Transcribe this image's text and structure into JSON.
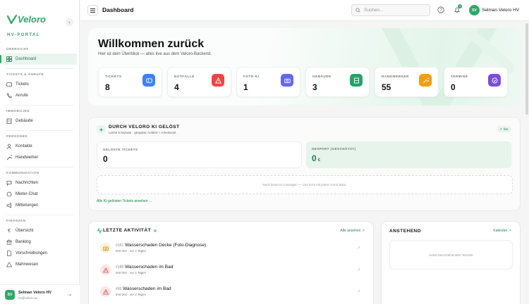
{
  "sidebar": {
    "brand": "Veloro",
    "portal": "HV-PORTAL",
    "sections": [
      {
        "title": "ÜBERSICHT",
        "items": [
          {
            "label": "Dashboard",
            "icon": "dashboard-icon",
            "active": true
          }
        ]
      },
      {
        "title": "TICKETS & ANRUFE",
        "items": [
          {
            "label": "Tickets",
            "icon": "ticket-icon"
          },
          {
            "label": "Anrufe",
            "icon": "phone-icon"
          }
        ]
      },
      {
        "title": "IMMOBILIEN",
        "items": [
          {
            "label": "Gebäude",
            "icon": "building-icon"
          }
        ]
      },
      {
        "title": "PERSONEN",
        "items": [
          {
            "label": "Kontakte",
            "icon": "contacts-icon"
          },
          {
            "label": "Handwerker",
            "icon": "wrench-icon"
          }
        ]
      },
      {
        "title": "KOMMUNIKATION",
        "items": [
          {
            "label": "Nachrichten",
            "icon": "message-icon"
          },
          {
            "label": "Mieter-Chat",
            "icon": "chat-icon"
          },
          {
            "label": "Mitteilungen",
            "icon": "megaphone-icon"
          }
        ]
      },
      {
        "title": "FINANZEN",
        "items": [
          {
            "label": "Übersicht",
            "icon": "euro-icon"
          },
          {
            "label": "Banking",
            "icon": "bank-icon"
          },
          {
            "label": "Vorschreibungen",
            "icon": "document-icon"
          },
          {
            "label": "Mahnwesen",
            "icon": "warning-icon"
          }
        ]
      }
    ],
    "user": {
      "initials": "SV",
      "name": "Selman Veloro HV",
      "email": "hv@veloro.at"
    }
  },
  "topbar": {
    "title": "Dashboard",
    "search_placeholder": "Suchen...",
    "notifications": "3",
    "user_initials": "SV",
    "user_name": "Selman Veloro HV"
  },
  "hero": {
    "title": "Willkommen zurück",
    "subtitle": "Hier ist dein Überblick — alles live aus dem Veloro-Backend.",
    "stats": [
      {
        "label": "TICKETS",
        "value": "8",
        "icon": "ticket-icon",
        "color": "#3b82f6"
      },
      {
        "label": "NOTFÄLLE",
        "value": "4",
        "icon": "alert-icon",
        "color": "#ef4444"
      },
      {
        "label": "FOTO-KI",
        "value": "1",
        "icon": "camera-icon",
        "color": "#6366f1"
      },
      {
        "label": "GEBÄUDE",
        "value": "3",
        "icon": "building-icon",
        "color": "#22a36a"
      },
      {
        "label": "HANDWERKER",
        "value": "55",
        "icon": "wrench-icon",
        "color": "#f59e0b"
      },
      {
        "label": "TERMINE",
        "value": "0",
        "icon": "check-icon",
        "color": "#7c4ddb"
      }
    ]
  },
  "ki": {
    "title": "DURCH VELORO KI GELÖST",
    "subtitle": "Letzte 6 Monate · gespartе Anfahrt + Arbeitszeit",
    "live": "live",
    "solved_label": "GELÖSTE TICKETS",
    "solved_value": "0",
    "saved_label": "GESPART (GESCHÄTZT)",
    "saved_value": "0",
    "saved_unit": "€",
    "empty": "Noch keine KI-Lösungen — Lisa lernt mit jedem Anruf dazu.",
    "link": "Alle KI-gelösten Tickets ansehen"
  },
  "activities": {
    "title": "LETZTE AKTIVITÄT",
    "all": "Alle ansehen",
    "rows": [
      {
        "num": "#181",
        "title": "Wasserschaden Decke (Foto-Diagnose)",
        "sub": "test test · vor 2 Tagen",
        "icon": "camera-icon",
        "bg": "#fdf2d8",
        "fg": "#c98a12"
      },
      {
        "num": "#188",
        "title": "Wasserschaden im Bad",
        "sub": "test test · vor 2 Tagen",
        "icon": "alert-icon",
        "bg": "#fde4e4",
        "fg": "#e04848"
      },
      {
        "num": "#99",
        "title": "Wasserschaden im Bad",
        "sub": "test test · vor 2 Tagen",
        "icon": "alert-icon",
        "bg": "#fde4e4",
        "fg": "#e04848"
      }
    ]
  },
  "upcoming": {
    "title": "ANSTEHEND",
    "link": "Kalender",
    "empty": "Keine bevorstehenden Termine"
  }
}
